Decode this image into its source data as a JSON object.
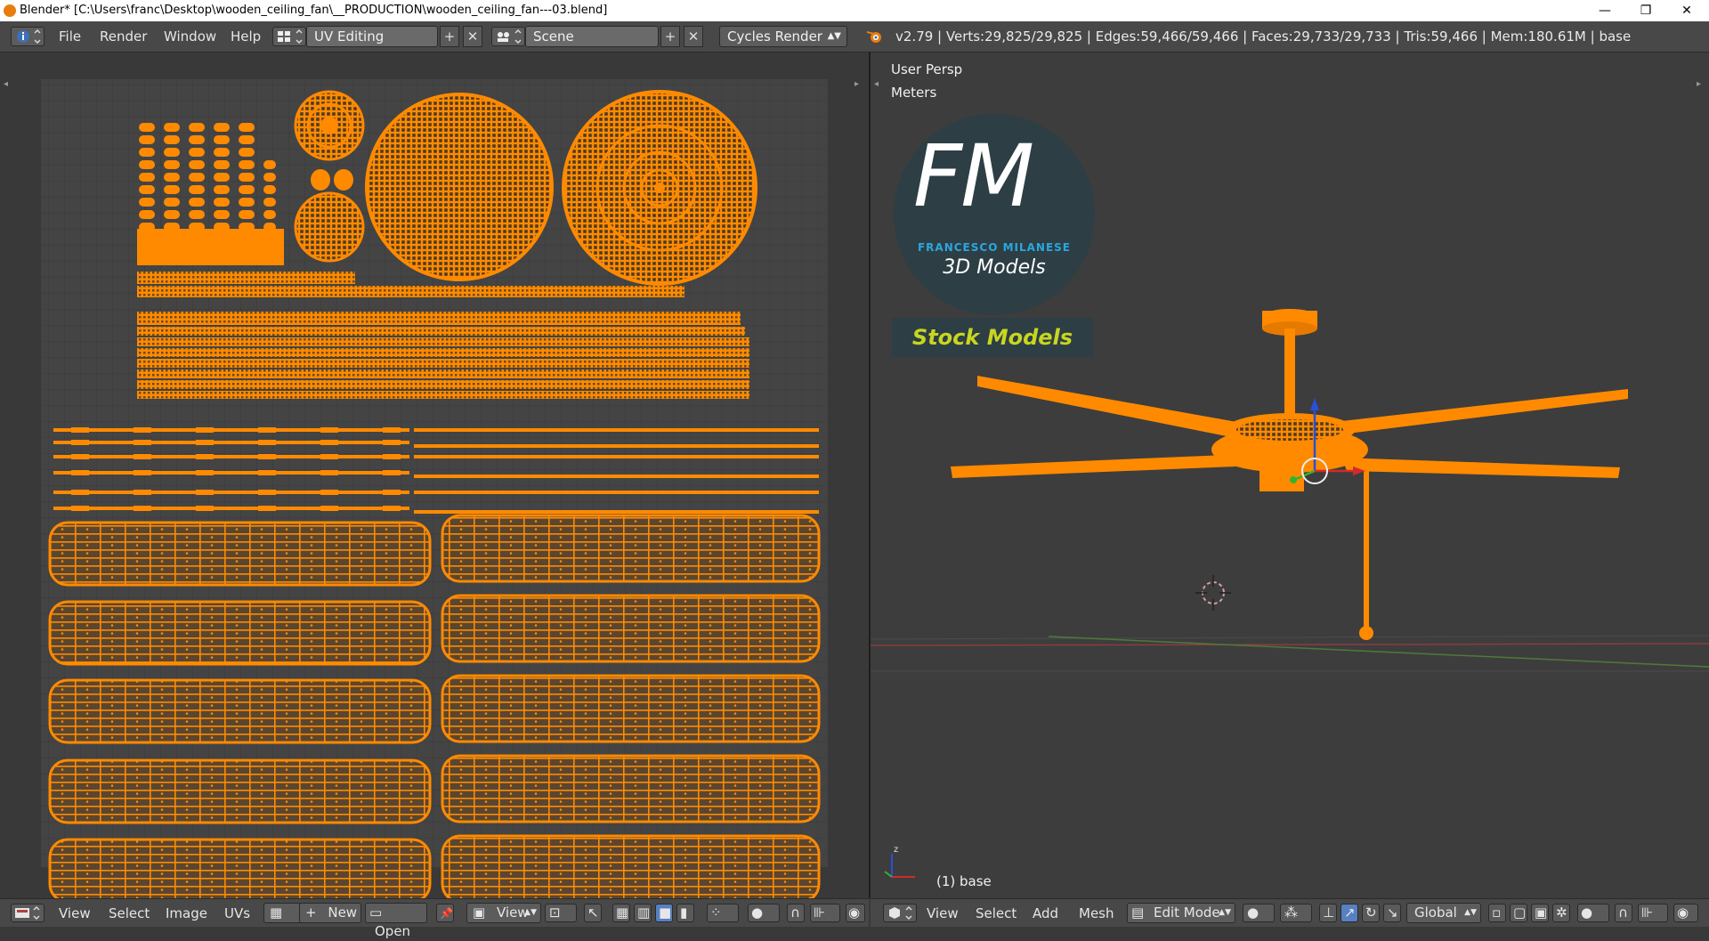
{
  "window": {
    "title": "Blender* [C:\\Users\\franc\\Desktop\\wooden_ceiling_fan\\__PRODUCTION\\wooden_ceiling_fan---03.blend]",
    "minimize": "—",
    "restore": "❐",
    "close": "✕"
  },
  "header": {
    "menus": [
      "File",
      "Render",
      "Window",
      "Help"
    ],
    "layout": "UV Editing",
    "scene": "Scene",
    "engine": "Cycles Render",
    "stats": "v2.79 | Verts:29,825/29,825 | Edges:59,466/59,466 | Faces:29,733/29,733 | Tris:59,466 | Mem:180.61M | base"
  },
  "viewport": {
    "view_name": "User Persp",
    "units": "Meters",
    "object_label": "(1) base",
    "logo": {
      "letters": "FM",
      "name": "FRANCESCO MILANESE",
      "subtitle": "3D Models",
      "banner": "Stock Models"
    }
  },
  "uv_footer": {
    "menus": [
      "View",
      "Select",
      "Image",
      "UVs"
    ],
    "new": "New",
    "open": "Open",
    "view": "View"
  },
  "view_footer": {
    "menus": [
      "View",
      "Select",
      "Add",
      "Mesh"
    ],
    "mode": "Edit Mode",
    "orientation": "Global"
  },
  "colors": {
    "mesh": "#ff8a00",
    "background": "#393939",
    "header": "#484848",
    "accent_blue": "#5680c2"
  }
}
